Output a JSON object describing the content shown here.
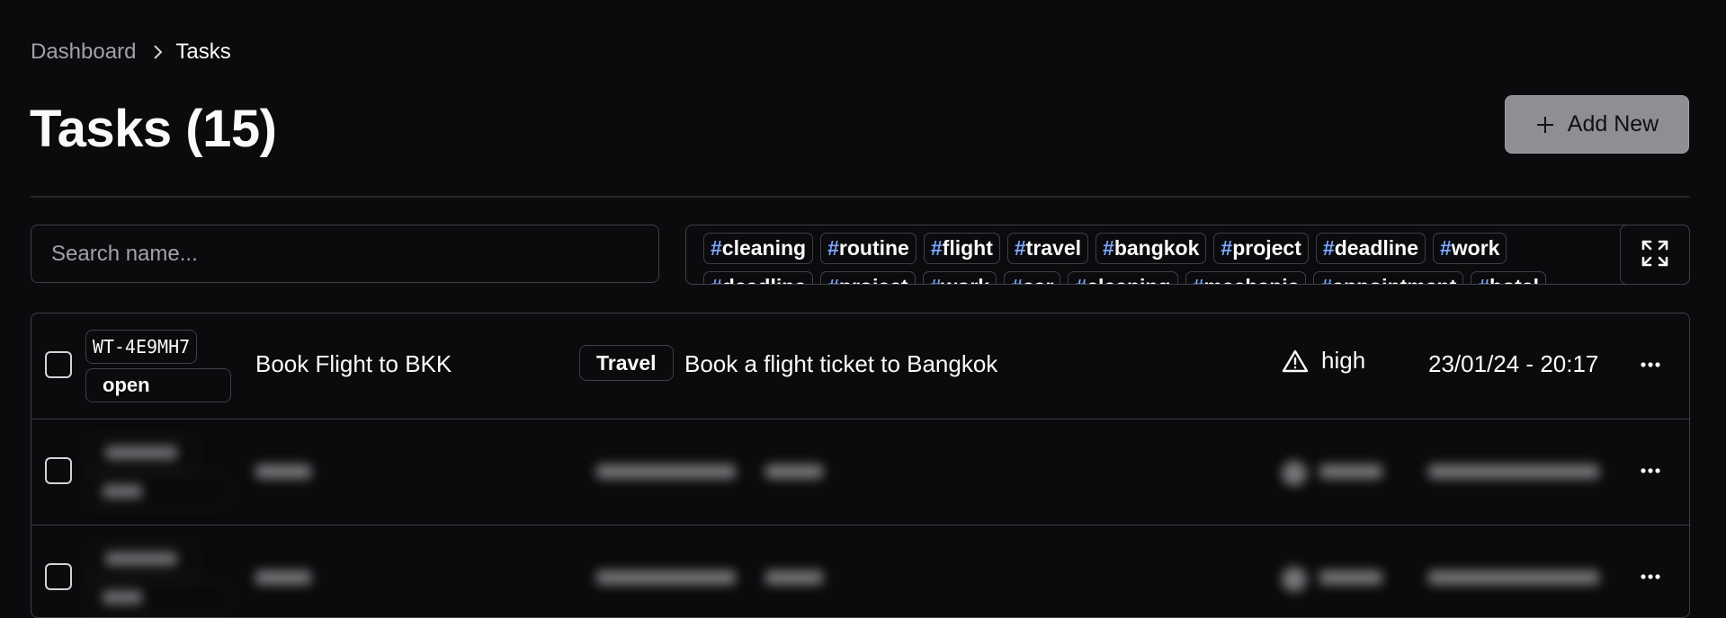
{
  "breadcrumb": {
    "parent": "Dashboard",
    "current": "Tasks"
  },
  "page": {
    "title": "Tasks (15)"
  },
  "actions": {
    "add_new_label": "Add New"
  },
  "search": {
    "placeholder": "Search name..."
  },
  "tags": {
    "row1": [
      "cleaning",
      "routine",
      "flight",
      "travel",
      "bangkok",
      "project",
      "deadline",
      "work"
    ],
    "row2": [
      "deadline",
      "project",
      "work",
      "car",
      "cleaning",
      "mechanic",
      "appointment",
      "hotel"
    ]
  },
  "tasks": {
    "first": {
      "id": "WT-4E9MH7",
      "status": "open",
      "title": "Book Flight to BKK",
      "label": "Travel",
      "description": "Book a flight ticket to Bangkok",
      "priority": "high",
      "date": "23/01/24 - 20:17"
    }
  },
  "icons": {
    "breadcrumb_separator": "chevron-right-icon",
    "add": "plus-icon",
    "expand": "expand-icon",
    "priority_high": "warning-triangle-icon",
    "row_menu": "more-horizontal-icon"
  },
  "colors": {
    "tag_hash": "#7ca7ff",
    "add_button": "#8f8f93",
    "background": "#0b0b0d"
  }
}
